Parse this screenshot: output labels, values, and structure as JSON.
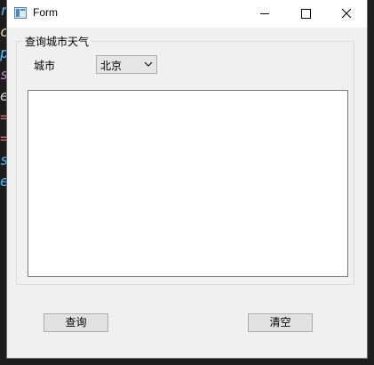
{
  "window": {
    "title": "Form",
    "minimize_icon": "minimize-icon",
    "maximize_icon": "maximize-icon",
    "close_icon": "close-icon"
  },
  "group": {
    "title": "查询城市天气",
    "city_label": "城市",
    "city_select": {
      "selected": "北京",
      "arrow_icon": "chevron-down-icon"
    },
    "result_text": ""
  },
  "buttons": {
    "query_label": "查询",
    "clear_label": "清空"
  },
  "background_editor": {
    "glyphs": [
      "r",
      "c",
      "p",
      "s",
      "e",
      "=",
      "=",
      "s",
      "e"
    ],
    "colors": [
      "#4fc1ff",
      "#dcdcaa",
      "#4fc1ff",
      "#c586c0",
      "#d4d4d4",
      "#d16969",
      "#d16969",
      "#4fc1ff",
      "#4fc1ff"
    ]
  }
}
